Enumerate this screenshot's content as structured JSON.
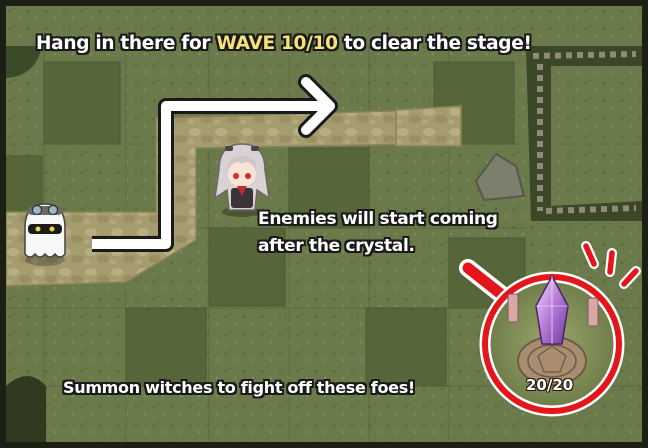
{
  "captions": {
    "top_prefix": "Hang in there for",
    "wave_label": "WAVE",
    "wave_count": "10/10",
    "top_suffix": "to clear the stage!",
    "mid_line1": "Enemies will start coming",
    "mid_line2": "after the crystal.",
    "bottom": "Summon witches to fight off these foes!"
  },
  "crystal": {
    "counter": "20/20"
  },
  "icons": {
    "path_arrow": "white-bent-arrow-icon",
    "enemy": "white-ghost-enemy-icon",
    "witch": "gray-haired-witch-icon",
    "crystal": "purple-crystal-icon",
    "pointer": "red-pointer-arrow-icon"
  },
  "colors": {
    "highlight_ring": "#e5151c",
    "wave_text": "#f6e27a",
    "grass": "#6b7a4a"
  }
}
